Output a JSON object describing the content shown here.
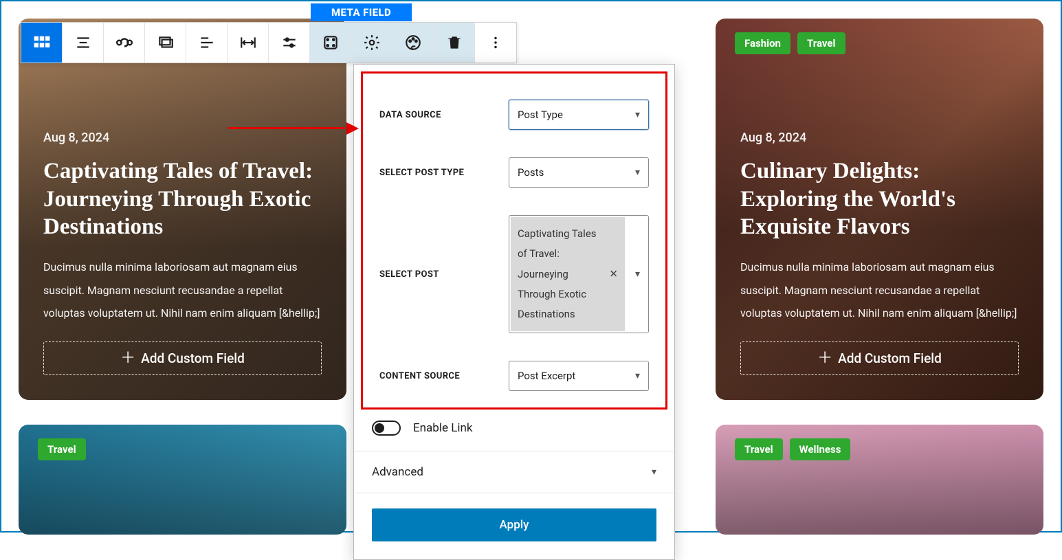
{
  "badge": "META FIELD",
  "toolbar_icons": [
    "grid-icon",
    "align-icon",
    "loop-icon",
    "stack-icon",
    "justify-icon",
    "width-icon",
    "sliders-icon",
    "padding-icon",
    "gear-icon",
    "styles-icon",
    "trash-icon",
    "more-icon"
  ],
  "cards": [
    {
      "date": "Aug 8, 2024",
      "title": "Captivating Tales of Travel: Journeying Through Exotic Destinations",
      "excerpt": "Ducimus nulla minima laboriosam aut magnam eius suscipit. Magnam nesciunt recusandae a repellat voluptas voluptatem ut. Nihil nam enim aliquam [&hellip;]",
      "add_label": "Add Custom Field"
    },
    {
      "tags": [
        "Fashion",
        "Travel"
      ],
      "date": "Aug 8, 2024",
      "title": "Culinary Delights: Exploring the World's Exquisite Flavors",
      "excerpt": "Ducimus nulla minima laboriosam aut magnam eius suscipit. Magnam nesciunt recusandae a repellat voluptas voluptatem ut. Nihil nam enim aliquam [&hellip;]",
      "add_label": "Add Custom Field"
    },
    {
      "tags": [
        "Travel"
      ]
    },
    {
      "tags": [
        "Travel",
        "Wellness"
      ]
    }
  ],
  "popover": {
    "fields": {
      "data_source": {
        "label": "DATA SOURCE",
        "value": "Post Type"
      },
      "post_type": {
        "label": "SELECT POST TYPE",
        "value": "Posts"
      },
      "select_post": {
        "label": "SELECT POST",
        "value": "Captivating Tales of Travel: Journeying Through Exotic Destinations"
      },
      "content_source": {
        "label": "CONTENT SOURCE",
        "value": "Post Excerpt"
      }
    },
    "enable_link": "Enable Link",
    "advanced": "Advanced",
    "apply": "Apply"
  }
}
